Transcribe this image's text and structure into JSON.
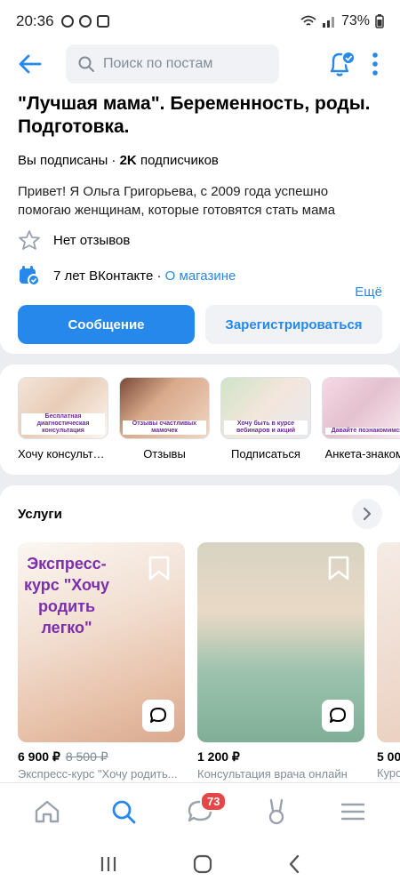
{
  "status_bar": {
    "time": "20:36",
    "battery": "73%"
  },
  "header": {
    "search_placeholder": "Поиск по постам"
  },
  "group": {
    "title": "\"Лучшая мама\". Беременность, роды. Подготовка.",
    "subscribed_text": "Вы подписаны · ",
    "subscribers_count": "2K",
    "subscribers_label": " подписчиков",
    "description": "Привет! Я Ольга Григорьева, с 2009 года успешно помогаю женщинам, которые готовятся стать мама",
    "more_label": "Ещё",
    "reviews": "Нет отзывов",
    "vk_years": "7 лет ВКонтакте · ",
    "shop_link": "О магазине"
  },
  "actions": {
    "message": "Сообщение",
    "register": "Зарегистрироваться"
  },
  "links": [
    {
      "label": "Хочу консульта...",
      "caption": "Бесплатная диагностическая консультация"
    },
    {
      "label": "Отзывы",
      "caption": "Отзывы счастливых мамочек"
    },
    {
      "label": "Подписаться",
      "caption": "Хочу быть в курсе вебинаров и акций"
    },
    {
      "label": "Анкета-знакомс",
      "caption": "Давайте познакомимся"
    }
  ],
  "services": {
    "title": "Услуги",
    "items": [
      {
        "price": "6 900 ₽",
        "old_price": "8 500 ₽",
        "name": "Экспресс-курс \"Хочу родить...",
        "image_text": "Экспресс-курс \"Хочу родить легко\""
      },
      {
        "price": "1 200 ₽",
        "old_price": "",
        "name": "Консультация врача онлайн",
        "image_text": ""
      },
      {
        "price": "5 00",
        "old_price": "",
        "name": "Курс",
        "image_text": ""
      }
    ]
  },
  "tabbar": {
    "messages_badge": "73"
  },
  "colors": {
    "accent": "#2688eb",
    "badge": "#e64646"
  }
}
